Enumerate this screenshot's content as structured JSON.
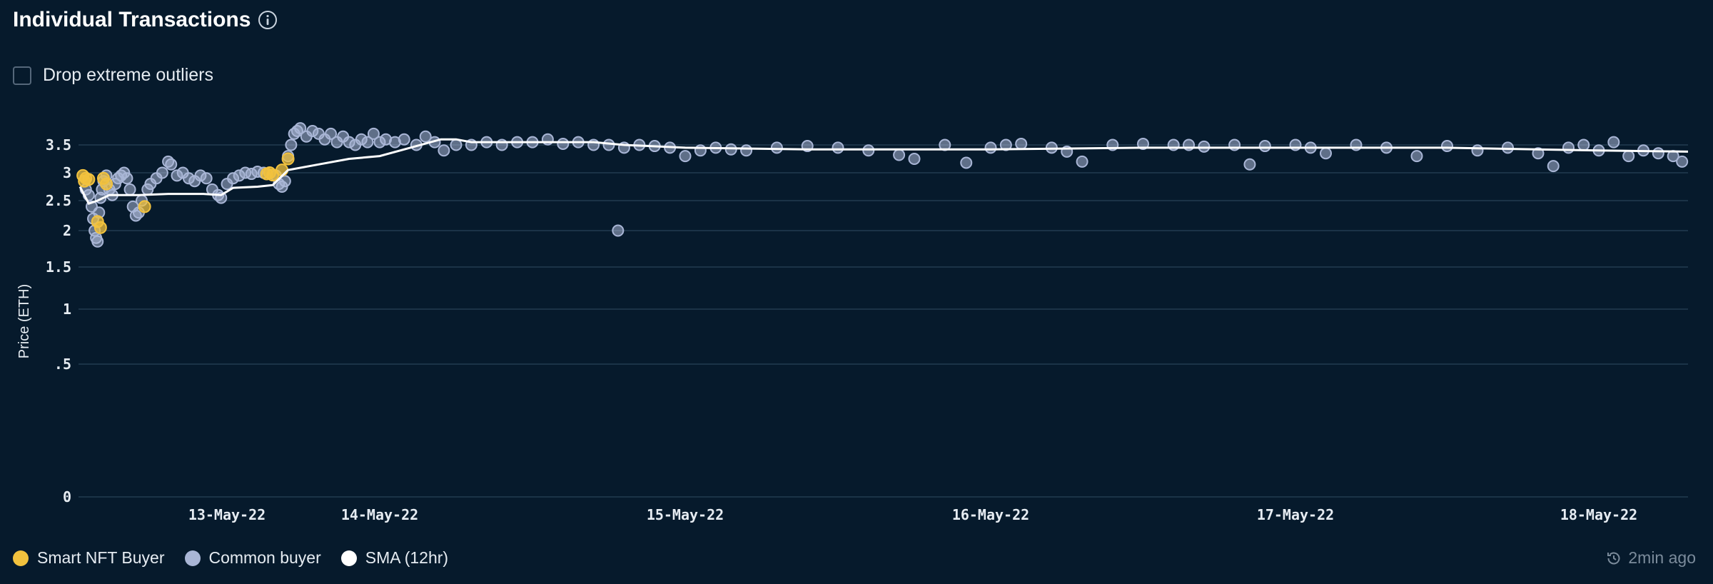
{
  "header": {
    "title": "Individual Transactions",
    "info_icon": "info-icon"
  },
  "filters": {
    "drop_outliers_label": "Drop extreme outliers",
    "drop_outliers_checked": false
  },
  "legend": [
    {
      "label": "Smart NFT Buyer",
      "color": "#f2c23e"
    },
    {
      "label": "Common buyer",
      "color": "#a9b6d6"
    },
    {
      "label": "SMA (12hr)",
      "color": "#ffffff"
    }
  ],
  "status": {
    "updated_label": "2min ago",
    "icon": "clock-history-icon"
  },
  "colors": {
    "background": "#061a2c",
    "grid": "#1b3347",
    "smart_buyer": "#f2c23e",
    "common_buyer": "#a9b6d6",
    "sma": "#ffffff"
  },
  "chart_data": {
    "type": "scatter",
    "ylabel": "Price (ETH)",
    "y_ticks": [
      {
        "value": 0,
        "label": "0"
      },
      {
        "value": 0.5,
        "label": ".5"
      },
      {
        "value": 1,
        "label": "1"
      },
      {
        "value": 1.5,
        "label": "1.5"
      },
      {
        "value": 2,
        "label": "2"
      },
      {
        "value": 2.5,
        "label": "2.5"
      },
      {
        "value": 3,
        "label": "3"
      },
      {
        "value": 3.5,
        "label": "3.5"
      }
    ],
    "x_ticks": [
      {
        "day": 0.5,
        "label": "13-May-22"
      },
      {
        "day": 1.0,
        "label": "14-May-22"
      },
      {
        "day": 2.0,
        "label": "15-May-22"
      },
      {
        "day": 3.0,
        "label": "16-May-22"
      },
      {
        "day": 4.0,
        "label": "17-May-22"
      },
      {
        "day": 5.0,
        "label": "18-May-22"
      }
    ],
    "x_range": [
      0.0,
      5.3
    ],
    "legend_position": "bottom-left",
    "series": [
      {
        "name": "Smart NFT Buyer",
        "points": [
          [
            0.01,
            2.95
          ],
          [
            0.02,
            2.9
          ],
          [
            0.015,
            2.85
          ],
          [
            0.03,
            2.88
          ],
          [
            0.06,
            2.15
          ],
          [
            0.07,
            2.05
          ],
          [
            0.08,
            2.9
          ],
          [
            0.09,
            2.8
          ],
          [
            0.22,
            2.4
          ],
          [
            0.63,
            2.98
          ],
          [
            0.64,
            3.0
          ],
          [
            0.65,
            2.96
          ],
          [
            0.68,
            3.05
          ],
          [
            0.7,
            3.25
          ]
        ]
      },
      {
        "name": "Common buyer",
        "points": [
          [
            0.02,
            2.7
          ],
          [
            0.03,
            2.6
          ],
          [
            0.04,
            2.4
          ],
          [
            0.045,
            2.2
          ],
          [
            0.05,
            2.0
          ],
          [
            0.055,
            1.9
          ],
          [
            0.06,
            1.85
          ],
          [
            0.065,
            2.3
          ],
          [
            0.07,
            2.55
          ],
          [
            0.075,
            2.7
          ],
          [
            0.08,
            2.85
          ],
          [
            0.09,
            2.95
          ],
          [
            0.1,
            2.7
          ],
          [
            0.11,
            2.6
          ],
          [
            0.12,
            2.8
          ],
          [
            0.13,
            2.9
          ],
          [
            0.14,
            2.95
          ],
          [
            0.15,
            3.0
          ],
          [
            0.16,
            2.9
          ],
          [
            0.17,
            2.7
          ],
          [
            0.18,
            2.4
          ],
          [
            0.19,
            2.25
          ],
          [
            0.2,
            2.3
          ],
          [
            0.21,
            2.5
          ],
          [
            0.23,
            2.7
          ],
          [
            0.24,
            2.8
          ],
          [
            0.26,
            2.9
          ],
          [
            0.28,
            3.0
          ],
          [
            0.3,
            3.2
          ],
          [
            0.31,
            3.15
          ],
          [
            0.33,
            2.95
          ],
          [
            0.35,
            3.0
          ],
          [
            0.37,
            2.9
          ],
          [
            0.39,
            2.85
          ],
          [
            0.41,
            2.95
          ],
          [
            0.43,
            2.9
          ],
          [
            0.45,
            2.7
          ],
          [
            0.47,
            2.6
          ],
          [
            0.48,
            2.55
          ],
          [
            0.5,
            2.8
          ],
          [
            0.52,
            2.9
          ],
          [
            0.54,
            2.95
          ],
          [
            0.56,
            3.0
          ],
          [
            0.58,
            2.98
          ],
          [
            0.6,
            3.02
          ],
          [
            0.62,
            3.0
          ],
          [
            0.66,
            2.95
          ],
          [
            0.67,
            2.8
          ],
          [
            0.68,
            2.75
          ],
          [
            0.69,
            2.85
          ],
          [
            0.7,
            3.3
          ],
          [
            0.71,
            3.5
          ],
          [
            0.72,
            3.7
          ],
          [
            0.73,
            3.75
          ],
          [
            0.74,
            3.8
          ],
          [
            0.76,
            3.65
          ],
          [
            0.78,
            3.75
          ],
          [
            0.8,
            3.7
          ],
          [
            0.82,
            3.6
          ],
          [
            0.84,
            3.7
          ],
          [
            0.86,
            3.55
          ],
          [
            0.88,
            3.65
          ],
          [
            0.9,
            3.55
          ],
          [
            0.92,
            3.5
          ],
          [
            0.94,
            3.6
          ],
          [
            0.96,
            3.55
          ],
          [
            0.98,
            3.7
          ],
          [
            1.0,
            3.55
          ],
          [
            1.02,
            3.6
          ],
          [
            1.05,
            3.55
          ],
          [
            1.08,
            3.6
          ],
          [
            1.12,
            3.5
          ],
          [
            1.15,
            3.65
          ],
          [
            1.18,
            3.55
          ],
          [
            1.21,
            3.4
          ],
          [
            1.25,
            3.5
          ],
          [
            1.3,
            3.5
          ],
          [
            1.35,
            3.55
          ],
          [
            1.4,
            3.5
          ],
          [
            1.45,
            3.55
          ],
          [
            1.5,
            3.55
          ],
          [
            1.55,
            3.6
          ],
          [
            1.6,
            3.52
          ],
          [
            1.65,
            3.55
          ],
          [
            1.7,
            3.5
          ],
          [
            1.75,
            3.5
          ],
          [
            1.78,
            2.0
          ],
          [
            1.8,
            3.45
          ],
          [
            1.85,
            3.5
          ],
          [
            1.9,
            3.48
          ],
          [
            1.95,
            3.45
          ],
          [
            2.0,
            3.3
          ],
          [
            2.05,
            3.4
          ],
          [
            2.1,
            3.45
          ],
          [
            2.15,
            3.42
          ],
          [
            2.2,
            3.4
          ],
          [
            2.3,
            3.45
          ],
          [
            2.4,
            3.48
          ],
          [
            2.5,
            3.45
          ],
          [
            2.6,
            3.4
          ],
          [
            2.7,
            3.32
          ],
          [
            2.75,
            3.25
          ],
          [
            2.85,
            3.5
          ],
          [
            2.92,
            3.18
          ],
          [
            3.0,
            3.45
          ],
          [
            3.05,
            3.5
          ],
          [
            3.1,
            3.52
          ],
          [
            3.2,
            3.45
          ],
          [
            3.25,
            3.38
          ],
          [
            3.3,
            3.2
          ],
          [
            3.4,
            3.5
          ],
          [
            3.5,
            3.52
          ],
          [
            3.6,
            3.5
          ],
          [
            3.65,
            3.5
          ],
          [
            3.7,
            3.47
          ],
          [
            3.8,
            3.5
          ],
          [
            3.85,
            3.15
          ],
          [
            3.9,
            3.48
          ],
          [
            4.0,
            3.5
          ],
          [
            4.05,
            3.45
          ],
          [
            4.1,
            3.35
          ],
          [
            4.2,
            3.5
          ],
          [
            4.3,
            3.45
          ],
          [
            4.4,
            3.3
          ],
          [
            4.5,
            3.48
          ],
          [
            4.6,
            3.4
          ],
          [
            4.7,
            3.45
          ],
          [
            4.8,
            3.35
          ],
          [
            4.85,
            3.12
          ],
          [
            4.9,
            3.45
          ],
          [
            4.95,
            3.5
          ],
          [
            5.0,
            3.4
          ],
          [
            5.05,
            3.55
          ],
          [
            5.1,
            3.3
          ],
          [
            5.15,
            3.4
          ],
          [
            5.2,
            3.35
          ],
          [
            5.25,
            3.3
          ],
          [
            5.28,
            3.2
          ]
        ]
      },
      {
        "name": "SMA (12hr)",
        "points": [
          [
            0.0,
            2.75
          ],
          [
            0.03,
            2.45
          ],
          [
            0.06,
            2.5
          ],
          [
            0.1,
            2.6
          ],
          [
            0.2,
            2.6
          ],
          [
            0.3,
            2.62
          ],
          [
            0.42,
            2.62
          ],
          [
            0.48,
            2.6
          ],
          [
            0.52,
            2.73
          ],
          [
            0.6,
            2.75
          ],
          [
            0.65,
            2.78
          ],
          [
            0.7,
            3.05
          ],
          [
            0.8,
            3.15
          ],
          [
            0.9,
            3.25
          ],
          [
            1.0,
            3.3
          ],
          [
            1.1,
            3.45
          ],
          [
            1.2,
            3.6
          ],
          [
            1.25,
            3.6
          ],
          [
            1.3,
            3.55
          ],
          [
            1.35,
            3.55
          ],
          [
            1.5,
            3.55
          ],
          [
            1.7,
            3.55
          ],
          [
            1.8,
            3.5
          ],
          [
            2.0,
            3.45
          ],
          [
            2.4,
            3.42
          ],
          [
            2.8,
            3.42
          ],
          [
            3.0,
            3.42
          ],
          [
            3.5,
            3.45
          ],
          [
            4.0,
            3.45
          ],
          [
            4.5,
            3.45
          ],
          [
            5.0,
            3.4
          ],
          [
            5.3,
            3.38
          ]
        ]
      }
    ]
  }
}
